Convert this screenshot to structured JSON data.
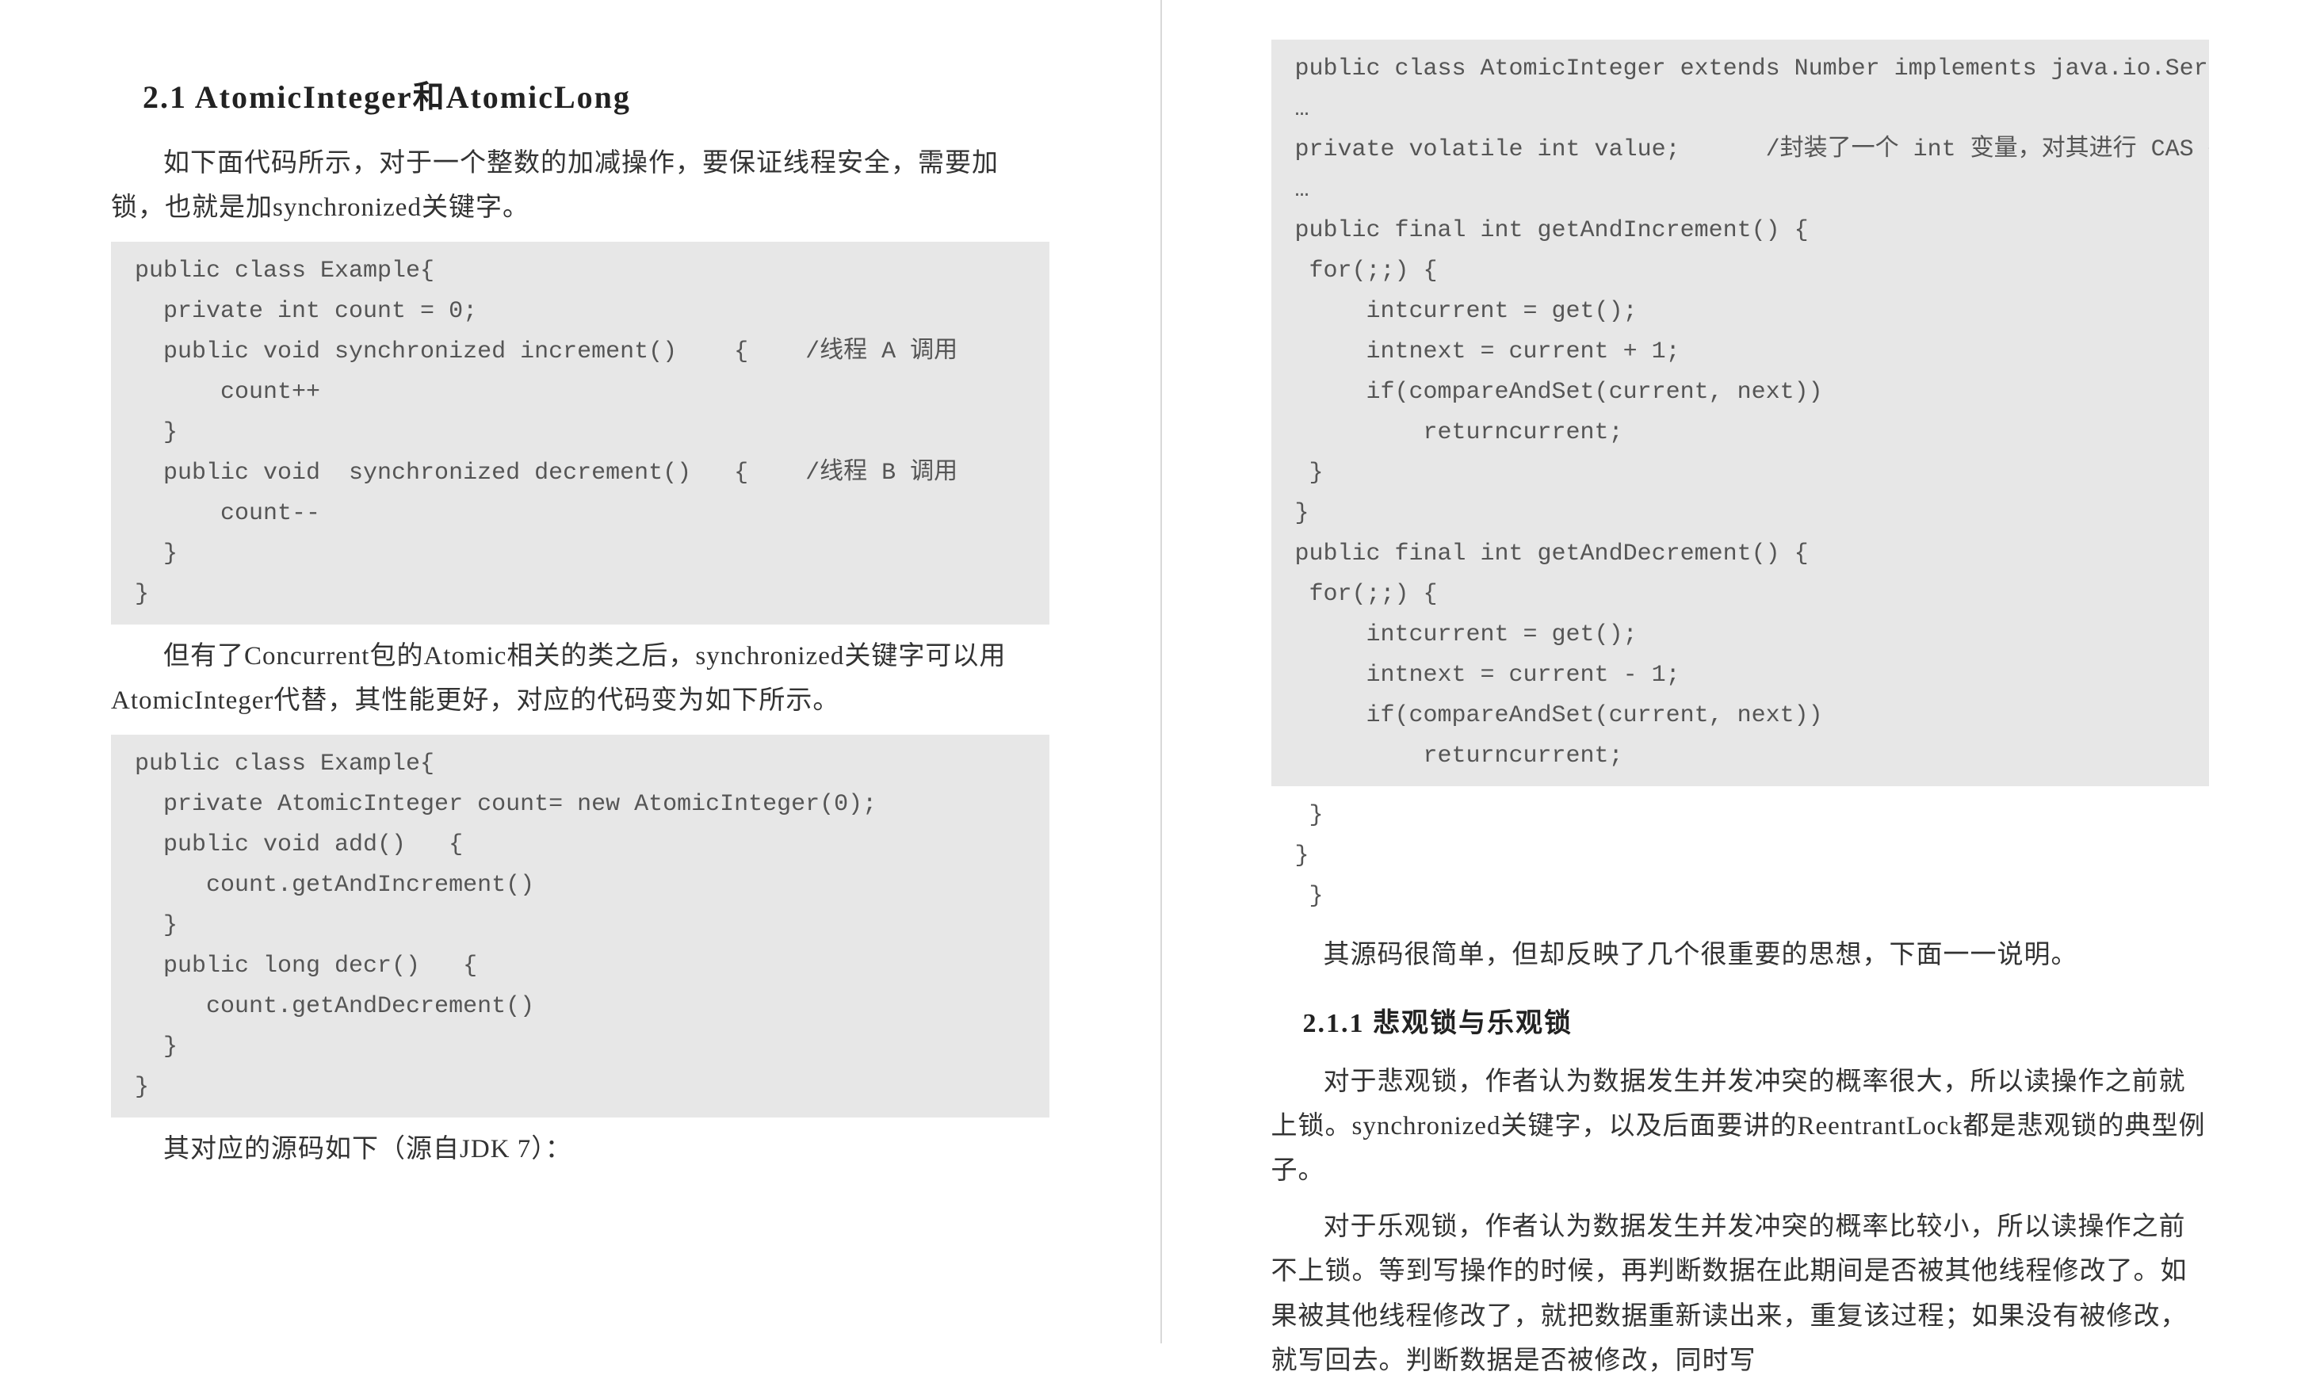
{
  "left": {
    "heading": "2.1 AtomicInteger和AtomicLong",
    "para1": "如下面代码所示，对于一个整数的加减操作，要保证线程安全，需要加锁，也就是加synchronized关键字。",
    "code1": "public class Example{\n  private int count = 0;\n  public void synchronized increment()    {    /线程 A 调用\n      count++\n  }\n  public void  synchronized decrement()   {    /线程 B 调用\n      count--\n  }\n}",
    "para2": "但有了Concurrent包的Atomic相关的类之后，synchronized关键字可以用AtomicInteger代替，其性能更好，对应的代码变为如下所示。",
    "code2": "public class Example{\n  private AtomicInteger count= new AtomicInteger(0);\n  public void add()   {\n     count.getAndIncrement()\n  }\n  public long decr()   {\n     count.getAndDecrement()\n  }\n}",
    "para3": "其对应的源码如下（源自JDK 7）："
  },
  "right": {
    "code1": "public class AtomicInteger extends Number implements java.io.Serializable {\n…\nprivate volatile int value;      /封装了一个 int 变量，对其进行 CAS 操作\n…\npublic final int getAndIncrement() {\n for(;;) {\n     intcurrent = get();\n     intnext = current + 1;\n     if(compareAndSet(current, next))\n         returncurrent;\n }\n}\npublic final int getAndDecrement() {\n for(;;) {\n     intcurrent = get();\n     intnext = current - 1;\n     if(compareAndSet(current, next))\n         returncurrent;",
    "code1_tail": " }\n}\n }",
    "para1": "其源码很简单，但却反映了几个很重要的思想，下面一一说明。",
    "subheading": "2.1.1 悲观锁与乐观锁",
    "para2": "对于悲观锁，作者认为数据发生并发冲突的概率很大，所以读操作之前就上锁。synchronized关键字，以及后面要讲的ReentrantLock都是悲观锁的典型例子。",
    "para3": "对于乐观锁，作者认为数据发生并发冲突的概率比较小，所以读操作之前不上锁。等到写操作的时候，再判断数据在此期间是否被其他线程修改了。如果被其他线程修改了，就把数据重新读出来，重复该过程；如果没有被修改，就写回去。判断数据是否被修改，同时写"
  }
}
